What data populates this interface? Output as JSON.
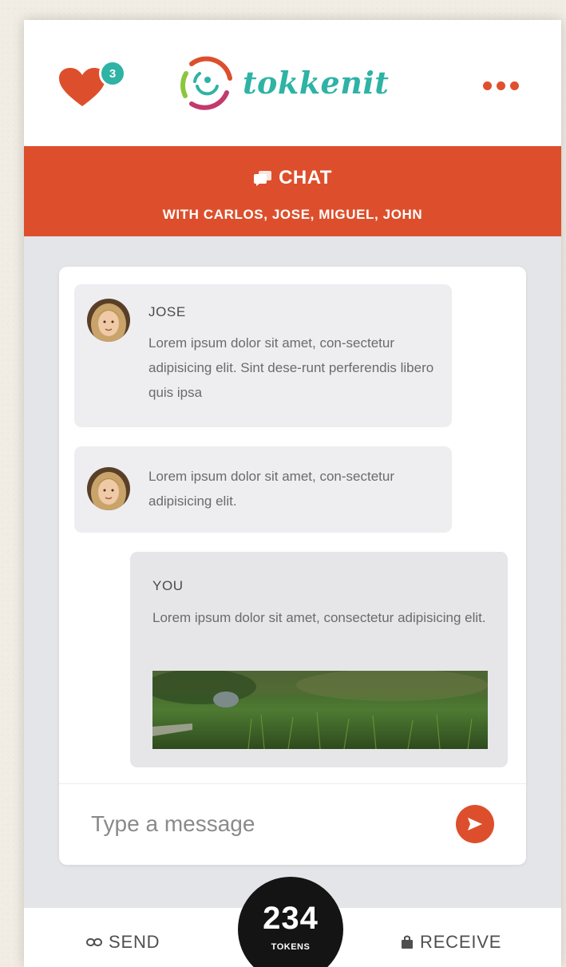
{
  "header": {
    "favorites_count": "3",
    "logo_text": "tokkenit"
  },
  "chat_bar": {
    "title": "CHAT",
    "subtitle": "WITH CARLOS, JOSE, MIGUEL,  JOHN"
  },
  "messages": [
    {
      "sender": "JOSE",
      "text": "Lorem ipsum dolor sit amet, con-sectetur adipisicing elit. Sint dese-runt perferendis libero quis ipsa"
    },
    {
      "sender": "",
      "text": "Lorem ipsum dolor sit amet, con-sectetur adipisicing elit."
    },
    {
      "sender": "YOU",
      "text": "Lorem ipsum dolor sit amet, consectetur adipisicing elit."
    }
  ],
  "composer": {
    "placeholder": "Type a message"
  },
  "bottom_bar": {
    "send_label": "SEND",
    "receive_label": "RECEIVE",
    "tokens_count": "234",
    "tokens_label": "TOKENS"
  },
  "colors": {
    "accent": "#dd4f2c",
    "teal": "#2eb3a5",
    "background": "#e4e5e8"
  },
  "icons": [
    "heart-icon",
    "logo-icon",
    "more-icon",
    "chat-icon",
    "send-arrow-icon",
    "link-icon",
    "bag-icon"
  ]
}
